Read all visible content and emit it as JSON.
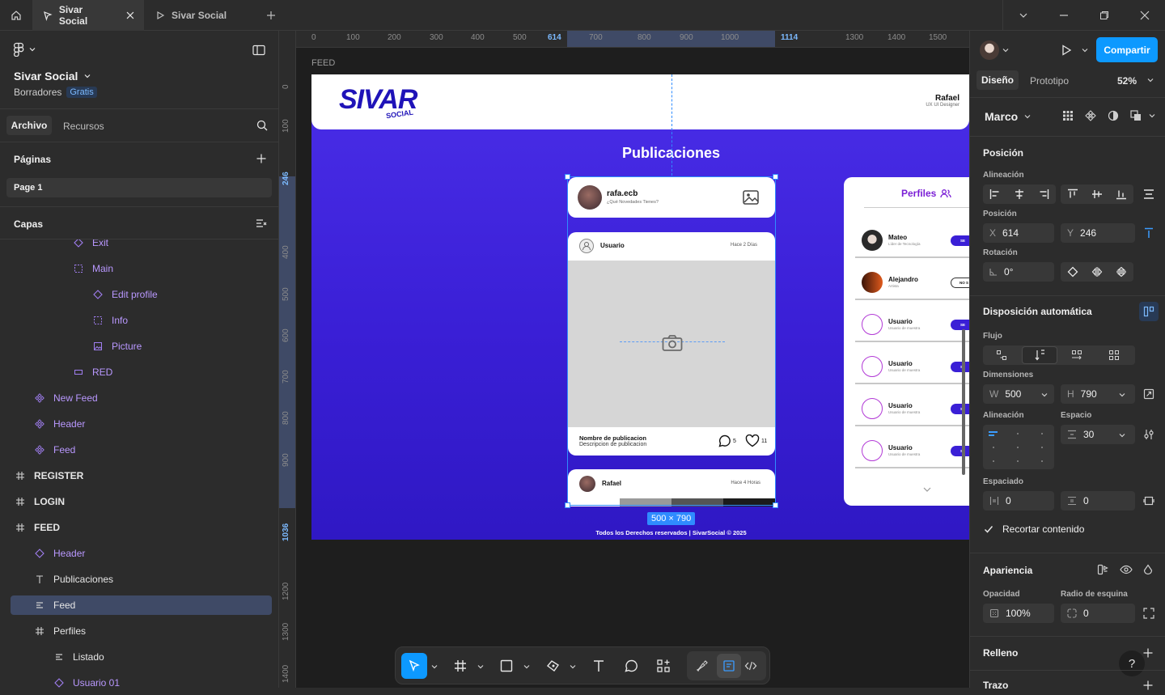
{
  "tabs": [
    {
      "label": "Sivar Social",
      "active": true
    },
    {
      "label": "Sivar Social",
      "active": false
    }
  ],
  "file": {
    "name": "Sivar Social",
    "location": "Borradores",
    "plan": "Gratis"
  },
  "left_tabs": {
    "file": "Archivo",
    "assets": "Recursos"
  },
  "pages": {
    "title": "Páginas",
    "items": [
      "Page 1"
    ]
  },
  "layers": {
    "title": "Capas",
    "items": [
      {
        "label": "Exit",
        "icon": "component-instance-icon",
        "purple": true,
        "indent": 3
      },
      {
        "label": "Main",
        "icon": "frame-dashed-icon",
        "purple": true,
        "indent": 3
      },
      {
        "label": "Edit profile",
        "icon": "component-instance-icon",
        "purple": true,
        "indent": 4
      },
      {
        "label": "Info",
        "icon": "frame-dashed-icon",
        "purple": true,
        "indent": 4
      },
      {
        "label": "Picture",
        "icon": "image-icon",
        "purple": true,
        "indent": 4
      },
      {
        "label": "RED",
        "icon": "rectangle-icon",
        "purple": true,
        "indent": 3
      },
      {
        "label": "New Feed",
        "icon": "component-icon",
        "purple": true,
        "indent": 1
      },
      {
        "label": "Header",
        "icon": "component-icon",
        "purple": true,
        "indent": 1
      },
      {
        "label": "Feed",
        "icon": "component-icon",
        "purple": true,
        "indent": 1
      },
      {
        "label": "REGISTER",
        "icon": "frame-icon",
        "purple": false,
        "indent": 0,
        "bold": true
      },
      {
        "label": "LOGIN",
        "icon": "frame-icon",
        "purple": false,
        "indent": 0,
        "bold": true
      },
      {
        "label": "FEED",
        "icon": "frame-icon",
        "purple": false,
        "indent": 0,
        "bold": true
      },
      {
        "label": "Header",
        "icon": "component-instance-icon",
        "purple": true,
        "indent": 1
      },
      {
        "label": "Publicaciones",
        "icon": "text-icon",
        "purple": false,
        "indent": 1
      },
      {
        "label": "Feed",
        "icon": "autolayout-icon",
        "purple": false,
        "indent": 1,
        "selected": true
      },
      {
        "label": "Perfiles",
        "icon": "frame-icon",
        "purple": false,
        "indent": 1
      },
      {
        "label": "Listado",
        "icon": "autolayout-icon",
        "purple": false,
        "indent": 2
      },
      {
        "label": "Usuario 01",
        "icon": "component-instance-icon",
        "purple": true,
        "indent": 2
      }
    ]
  },
  "ruler": {
    "top": [
      "0",
      "100",
      "200",
      "300",
      "400",
      "500",
      "614",
      "700",
      "800",
      "900",
      "1000",
      "1114",
      "1300",
      "1400",
      "1500"
    ],
    "left": [
      "0",
      "100",
      "246",
      "400",
      "500",
      "600",
      "700",
      "800",
      "900",
      "1036",
      "1200",
      "1300",
      "1400"
    ]
  },
  "canvas": {
    "frame_label": "FEED",
    "header": {
      "user_name": "Rafael",
      "user_role": "UX UI Designer",
      "logo_main": "SIVAR",
      "logo_sub": "SOCIAL"
    },
    "section_title": "Publicaciones",
    "composer": {
      "username": "rafa.ecb",
      "prompt": "¿Qué Novedades Tienes?"
    },
    "post": {
      "username": "Usuario",
      "time": "Hace 2 Días",
      "title": "Nombre de publicacion",
      "desc": "Descripcion de publicacion",
      "comments": "5",
      "likes": "11"
    },
    "post2": {
      "username": "Rafael",
      "time": "Hace 4 Horas"
    },
    "size_badge": "500 × 790",
    "footer": "Todos los Derechos reservados | SivarSocial © 2025",
    "profiles": {
      "title": "Perfiles",
      "items": [
        {
          "name": "Mateo",
          "role": "Líder de Tecnología",
          "btn": "SE"
        },
        {
          "name": "Alejandro",
          "role": "Artista",
          "btn": "NO S"
        },
        {
          "name": "Usuario",
          "role": "Usuario de muestra",
          "btn": "SE"
        },
        {
          "name": "Usuario",
          "role": "Usuario de muestra",
          "btn": "SE"
        },
        {
          "name": "Usuario",
          "role": "Usuario de muestra",
          "btn": "SE"
        },
        {
          "name": "Usuario",
          "role": "Usuario de muestra",
          "btn": "SE"
        }
      ]
    }
  },
  "right": {
    "share": "Compartir",
    "tabs": {
      "design": "Diseño",
      "prototype": "Prototipo"
    },
    "zoom": "52%",
    "frame_type": "Marco",
    "position_title": "Posición",
    "alignment_label": "Alineación",
    "position_label": "Posición",
    "x_label": "X",
    "x": "614",
    "y_label": "Y",
    "y": "246",
    "rotation_label": "Rotación",
    "rotation": "0°",
    "autolayout_title": "Disposición automática",
    "flow_label": "Flujo",
    "dimensions_label": "Dimensiones",
    "w_label": "W",
    "w": "500",
    "h_label": "H",
    "h": "790",
    "al_align_label": "Alineación",
    "gap_label": "Espacio",
    "gap": "30",
    "padding_label": "Espaciado",
    "pad_h": "0",
    "pad_v": "0",
    "clip_label": "Recortar contenido",
    "appearance_title": "Apariencia",
    "opacity_label": "Opacidad",
    "opacity": "100%",
    "radius_label": "Radio de esquina",
    "radius": "0",
    "fill_title": "Relleno",
    "stroke_title": "Trazo",
    "help": "?"
  },
  "colors": {
    "accent": "#0d99ff",
    "purple_layer": "#b998ff",
    "canvas_brand": "#3b1fd6",
    "selection": "#3f4a66"
  }
}
